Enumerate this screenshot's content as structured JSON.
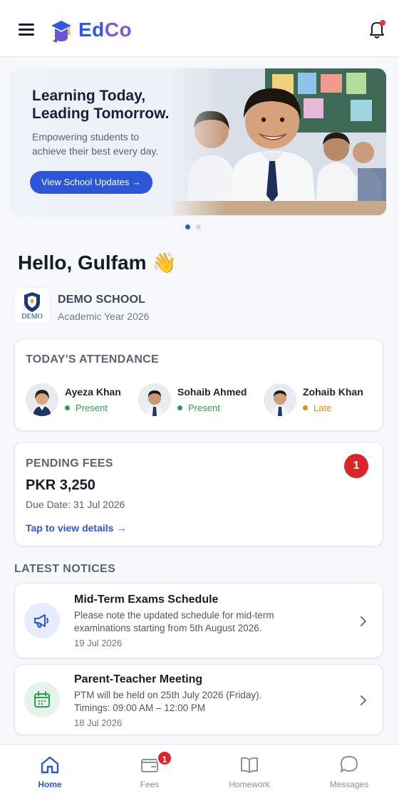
{
  "header": {
    "logo_text_ed": "Ed",
    "logo_text_co": "Co",
    "menu_icon": "hamburger-menu-icon",
    "notification_icon": "bell-icon",
    "has_unread_notification": true
  },
  "banner": {
    "title_line1": "Learning Today,",
    "title_line2": "Leading Tomorrow.",
    "subtitle_line1": "Empowering students to",
    "subtitle_line2": "achieve their best every day.",
    "button_label": "View School Updates →",
    "slide_count": 2,
    "active_slide": 1
  },
  "greeting": {
    "text": "Hello, Gulfam",
    "emoji": "👋"
  },
  "school": {
    "logo_text": "DEMO",
    "name": "DEMO SCHOOL",
    "academic_year": "Academic Year 2026"
  },
  "attendance": {
    "title": "TODAY'S ATTENDANCE",
    "students": [
      {
        "name": "Ayeza Khan",
        "status": "Present",
        "status_color": "#2e9f4f"
      },
      {
        "name": "Sohaib Ahmed",
        "status": "Present",
        "status_color": "#2e9f4f"
      },
      {
        "name": "Zohaib Khan",
        "status": "Late",
        "status_color": "#e58a1f"
      }
    ]
  },
  "fees": {
    "title": "PENDING FEES",
    "badge_count": "1",
    "amount": "PKR 3,250",
    "due_date": "Due Date: 31 Jul 2026",
    "link_label": "Tap to view details →"
  },
  "notices": {
    "title": "LATEST NOTICES",
    "items": [
      {
        "title": "Mid-Term Exams Schedule",
        "body": "Please note the updated schedule for mid-term examinations starting from 5th August 2026.",
        "date": "19 Jul 2026",
        "icon": "megaphone-icon"
      },
      {
        "title": "Parent-Teacher Meeting",
        "body": "PTM will be held on 25th July 2026 (Friday). Timings: 09:00 AM – 12:00 PM",
        "date": "18 Jul 2026",
        "icon": "calendar-icon"
      }
    ]
  },
  "bottom_nav": {
    "items": [
      {
        "label": "Home",
        "icon": "home-icon",
        "active": true
      },
      {
        "label": "Fees",
        "icon": "wallet-icon",
        "badge": "1"
      },
      {
        "label": "Homework",
        "icon": "book-icon"
      },
      {
        "label": "Messages",
        "icon": "chat-bubble-icon"
      }
    ]
  },
  "colors": {
    "primary": "#2b57d6",
    "present": "#2e9f4f",
    "late": "#e58a1f",
    "badge": "#d9262a"
  }
}
